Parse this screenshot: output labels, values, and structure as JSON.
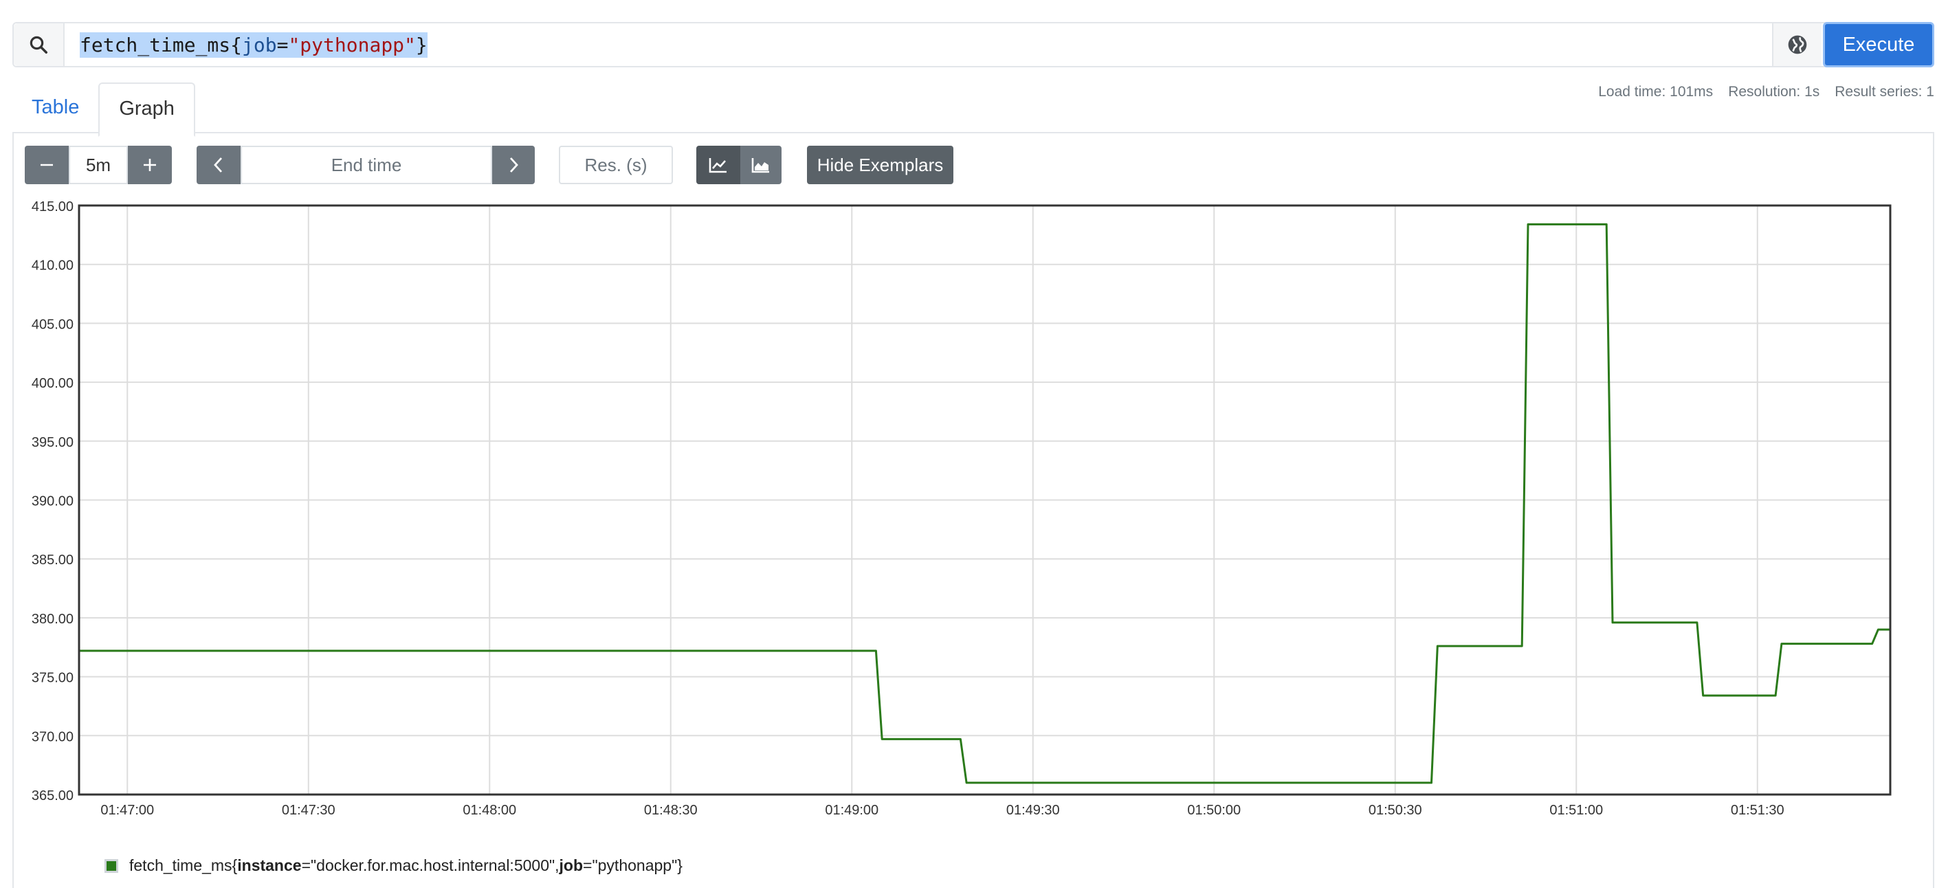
{
  "query": {
    "metric": "fetch_time_ms",
    "label_key": "job",
    "label_value": "\"pythonapp\"",
    "execute_label": "Execute"
  },
  "tabs": [
    {
      "label": "Table"
    },
    {
      "label": "Graph"
    }
  ],
  "stats": {
    "load_time": "Load time: 101ms",
    "resolution": "Resolution: 1s",
    "result_series": "Result series: 1"
  },
  "controls": {
    "range": "5m",
    "end_time_placeholder": "End time",
    "res_placeholder": "Res. (s)",
    "hide_exemplars_label": "Hide Exemplars"
  },
  "icons": {
    "search": "search-icon",
    "globe": "globe-icon",
    "minus": "minus-icon",
    "plus": "plus-icon",
    "prev": "chevron-left-icon",
    "next": "chevron-right-icon",
    "line_chart": "line-chart-icon",
    "stacked_chart": "area-chart-icon"
  },
  "colors": {
    "accent": "#2a74d9",
    "series": "#2a7a1a",
    "grid": "#dddddd",
    "axis": "#333333"
  },
  "legend": {
    "metric": "fetch_time_ms{",
    "label1_key": "instance",
    "label1_value": "=\"docker.for.mac.host.internal:5000\", ",
    "label2_key": "job",
    "label2_value": "=\"pythonapp\"}"
  },
  "chart_data": {
    "type": "line",
    "y_ticks": [
      "415.00",
      "410.00",
      "405.00",
      "400.00",
      "395.00",
      "390.00",
      "385.00",
      "380.00",
      "375.00",
      "370.00",
      "365.00"
    ],
    "x_ticks": [
      "01:47:00",
      "01:47:30",
      "01:48:00",
      "01:48:30",
      "01:49:00",
      "01:49:30",
      "01:50:00",
      "01:50:30",
      "01:51:00",
      "01:51:30"
    ],
    "ylim": [
      365,
      415
    ],
    "grid": true,
    "series": [
      {
        "x": [
          "01:46:52",
          "01:49:04",
          "01:49:05",
          "01:49:18",
          "01:49:19",
          "01:50:36",
          "01:50:37",
          "01:50:51",
          "01:50:52",
          "01:51:05",
          "01:51:06",
          "01:51:20",
          "01:51:21",
          "01:51:33",
          "01:51:34",
          "01:51:49",
          "01:51:50",
          "01:51:52"
        ],
        "y": [
          377.2,
          377.2,
          369.7,
          369.7,
          366.0,
          366.0,
          377.6,
          377.6,
          413.4,
          413.4,
          379.6,
          379.6,
          373.4,
          373.4,
          377.8,
          377.8,
          379.0,
          379.0
        ]
      }
    ]
  }
}
